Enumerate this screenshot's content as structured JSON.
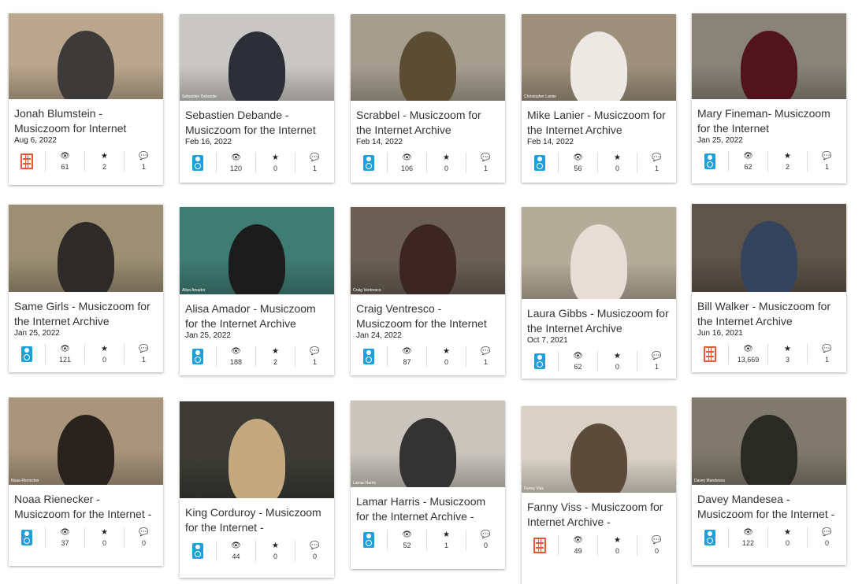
{
  "icons": {
    "views": "👁",
    "favorites": "★",
    "reviews": "💬"
  },
  "items": [
    {
      "title": "Jonah Blumstein - Musiczoom for Internet",
      "date": "Aug 6, 2022",
      "type": "movie",
      "views": "61",
      "favs": "2",
      "reviews": "1",
      "bg": "#b9a68c",
      "fg": "#3d3a3a",
      "caption": ""
    },
    {
      "title": "Sebastien Debande - Musiczoom for the Internet",
      "date": "Feb 16, 2022",
      "type": "audio",
      "views": "120",
      "favs": "0",
      "reviews": "1",
      "bg": "#c9c7c3",
      "fg": "#2c2f38",
      "caption": "Sebastien Debande"
    },
    {
      "title": "Scrabbel - Musiczoom for the Internet Archive",
      "date": "Feb 14, 2022",
      "type": "audio",
      "views": "106",
      "favs": "0",
      "reviews": "1",
      "bg": "#a59d8e",
      "fg": "#5b4d33",
      "caption": ""
    },
    {
      "title": "Mike Lanier - Musiczoom for the Internet Archive",
      "date": "Feb 14, 2022",
      "type": "audio",
      "views": "56",
      "favs": "0",
      "reviews": "1",
      "bg": "#9d8f7b",
      "fg": "#ece8e3",
      "caption": "Christopher Lanier"
    },
    {
      "title": "Mary Fineman- Musiczoom for the Internet",
      "date": "Jan 25, 2022",
      "type": "audio",
      "views": "62",
      "favs": "2",
      "reviews": "1",
      "bg": "#8a8478",
      "fg": "#51141d",
      "caption": ""
    },
    {
      "title": "Same Girls - Musiczoom for the Internet Archive",
      "date": "Jan 25, 2022",
      "type": "audio",
      "views": "121",
      "favs": "0",
      "reviews": "1",
      "bg": "#9c8f73",
      "fg": "#2d2a27",
      "caption": ""
    },
    {
      "title": "Alisa Amador - Musiczoom for the Internet Archive",
      "date": "Jan 25, 2022",
      "type": "audio",
      "views": "188",
      "favs": "2",
      "reviews": "1",
      "bg": "#3f7c74",
      "fg": "#1c1c1c",
      "caption": "Alisa Amador"
    },
    {
      "title": "Craig Ventresco - Musiczoom for the Internet",
      "date": "Jan 24, 2022",
      "type": "audio",
      "views": "87",
      "favs": "0",
      "reviews": "1",
      "bg": "#6a5f52",
      "fg": "#3b2622",
      "caption": "Craig Ventresco"
    },
    {
      "title": "Laura Gibbs - Musiczoom for the Internet Archive",
      "date": "Oct 7, 2021",
      "type": "audio",
      "views": "62",
      "favs": "0",
      "reviews": "1",
      "bg": "#b4ab98",
      "fg": "#e8dcd7",
      "caption": ""
    },
    {
      "title": "Bill Walker - Musiczoom for the Internet Archive",
      "date": "Jun 16, 2021",
      "type": "movie",
      "views": "13,669",
      "favs": "3",
      "reviews": "1",
      "bg": "#5e5449",
      "fg": "#34435e",
      "caption": ""
    },
    {
      "title": "Noaa Rienecker - Musiczoom for the Internet -",
      "date": "",
      "type": "audio",
      "views": "37",
      "favs": "0",
      "reviews": "0",
      "bg": "#a8957b",
      "fg": "#2a221d",
      "caption": "Noaa Rienecker"
    },
    {
      "title": "King Corduroy - Musiczoom for the Internet -",
      "date": "",
      "type": "audio",
      "views": "44",
      "favs": "0",
      "reviews": "0",
      "bg": "#3b3a34",
      "fg": "#c5a880",
      "caption": ""
    },
    {
      "title": "Lamar Harris - Musiczoom for the Internet Archive -",
      "date": "",
      "type": "audio",
      "views": "52",
      "favs": "1",
      "reviews": "0",
      "bg": "#c9c5bd",
      "fg": "#333333",
      "caption": "Lamar Harris"
    },
    {
      "title": "Fanny Viss - Musiczoom for Internet Archive -",
      "date": "",
      "type": "movie",
      "views": "49",
      "favs": "0",
      "reviews": "0",
      "bg": "#d8d1c4",
      "fg": "#5c4a3b",
      "caption": "Fanny Viss"
    },
    {
      "title": "Davey Mandesea - Musiczoom for the Internet -",
      "date": "",
      "type": "audio",
      "views": "122",
      "favs": "0",
      "reviews": "0",
      "bg": "#817a6c",
      "fg": "#2a2a25",
      "caption": "Davey Mandesea"
    }
  ]
}
